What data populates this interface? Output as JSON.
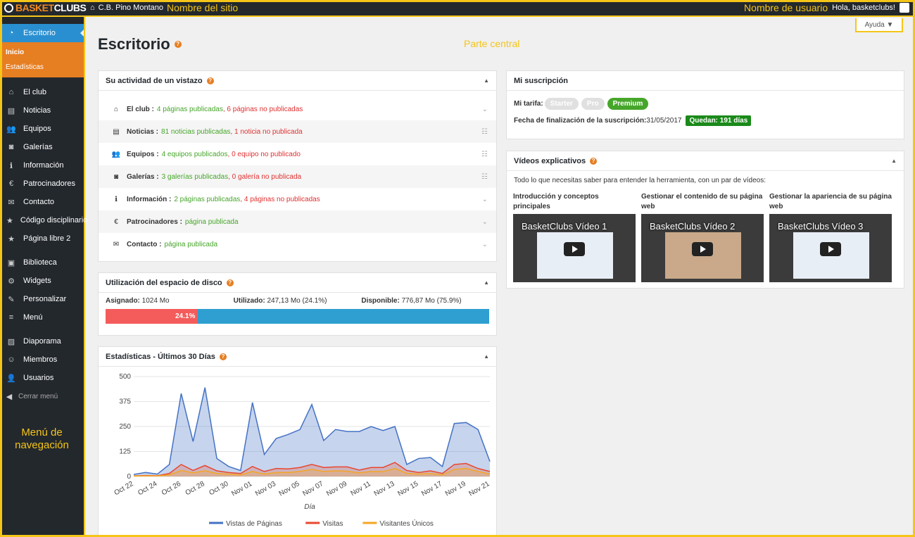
{
  "topbar": {
    "logo_left": "BASKET",
    "logo_right": "CLUBS",
    "site_name": "C.B. Pino Montano",
    "site_annotation": "Nombre del sitio",
    "user_annotation": "Nombre de usuario",
    "greeting": "Hola, basketclubs!"
  },
  "sidebar": {
    "active": "Escritorio",
    "submenu": [
      "Inicio",
      "Estadísticas"
    ],
    "group1": [
      "El club",
      "Noticias",
      "Equipos",
      "Galerías",
      "Información",
      "Patrocinadores",
      "Contacto",
      "Código disciplinario",
      "Página libre 2"
    ],
    "group2": [
      "Biblioteca",
      "Widgets",
      "Personalizar",
      "Menú"
    ],
    "group3": [
      "Diaporama",
      "Miembros",
      "Usuarios"
    ],
    "collapse": "Cerrar menú",
    "annotation_line1": "Menú de",
    "annotation_line2": "navegación"
  },
  "main": {
    "help_button": "Ayuda ▼",
    "title": "Escritorio",
    "center_annotation": "Parte central"
  },
  "activity": {
    "title": "Su actividad de un vistazo",
    "rows": [
      {
        "label": "El club :",
        "pub": "4 páginas publicadas",
        "unpub": ", 6 páginas no publicadas"
      },
      {
        "label": "Noticias :",
        "pub": "81 noticias publicadas",
        "unpub": ", 1 noticia no publicada"
      },
      {
        "label": "Equipos :",
        "pub": "4 equipos publicados",
        "unpub": ", 0 equipo no publicado"
      },
      {
        "label": "Galerías :",
        "pub": "3 galerías publicadas",
        "unpub": ", 0 galería no publicada"
      },
      {
        "label": "Información :",
        "pub": "2 páginas publicadas",
        "unpub": ", 4 páginas no publicadas"
      },
      {
        "label": "Patrocinadores :",
        "pub": "página publicada",
        "unpub": ""
      },
      {
        "label": "Contacto :",
        "pub": "página publicada",
        "unpub": ""
      }
    ]
  },
  "disk": {
    "title": "Utilización del espacio de disco",
    "assigned_label": "Asignado:",
    "assigned": " 1024 Mo",
    "used_label": "Utilizado:",
    "used": " 247,13 Mo (24.1%)",
    "available_label": "Disponible:",
    "available": " 776,87 Mo (75.9%)",
    "percent_text": "24.1%",
    "percent": 24.1
  },
  "stats": {
    "title": "Estadísticas - Últimos 30 Días"
  },
  "chart_data": {
    "type": "area",
    "title": "",
    "xlabel": "Día",
    "ylabel": "",
    "ylim": [
      0,
      500
    ],
    "yticks": [
      0,
      125,
      250,
      375,
      500
    ],
    "x": [
      "Oct 22",
      "Oct 23",
      "Oct 24",
      "Oct 25",
      "Oct 26",
      "Oct 27",
      "Oct 28",
      "Oct 29",
      "Oct 30",
      "Oct 31",
      "Nov 01",
      "Nov 02",
      "Nov 03",
      "Nov 04",
      "Nov 05",
      "Nov 06",
      "Nov 07",
      "Nov 08",
      "Nov 09",
      "Nov 10",
      "Nov 11",
      "Nov 12",
      "Nov 13",
      "Nov 14",
      "Nov 15",
      "Nov 16",
      "Nov 17",
      "Nov 18",
      "Nov 19",
      "Nov 20",
      "Nov 21"
    ],
    "xticks": [
      "Oct 22",
      "Oct 24",
      "Oct 26",
      "Oct 28",
      "Oct 30",
      "Nov 01",
      "Nov 03",
      "Nov 05",
      "Nov 07",
      "Nov 09",
      "Nov 11",
      "Nov 13",
      "Nov 15",
      "Nov 17",
      "Nov 19",
      "Nov 21"
    ],
    "series": [
      {
        "name": "Vistas de Páginas",
        "color": "#4472c4",
        "values": [
          10,
          20,
          12,
          60,
          415,
          175,
          445,
          90,
          50,
          30,
          370,
          110,
          190,
          210,
          235,
          360,
          180,
          235,
          225,
          225,
          250,
          230,
          250,
          60,
          90,
          95,
          50,
          265,
          270,
          235,
          75
        ]
      },
      {
        "name": "Visitas",
        "color": "#e8472f",
        "values": [
          3,
          5,
          4,
          15,
          60,
          30,
          55,
          28,
          20,
          15,
          50,
          25,
          40,
          38,
          45,
          60,
          45,
          48,
          48,
          32,
          45,
          45,
          70,
          30,
          20,
          28,
          15,
          60,
          65,
          40,
          25
        ]
      },
      {
        "name": "Visitantes Únicos",
        "color": "#f5a623",
        "values": [
          2,
          3,
          3,
          8,
          30,
          18,
          28,
          15,
          12,
          8,
          25,
          12,
          20,
          20,
          25,
          35,
          25,
          28,
          26,
          18,
          25,
          24,
          40,
          16,
          12,
          15,
          8,
          35,
          40,
          25,
          12
        ]
      }
    ],
    "legend": "bottom",
    "grid": true
  },
  "subscription": {
    "title": "Mi suscripción",
    "tariff_label": "Mi tarifa:",
    "plans": [
      "Starter",
      "Pro",
      "Premium"
    ],
    "end_label": "Fecha de finalización de la suscripción:",
    "end_date": " 31/05/2017",
    "remaining": "Quedan: 191 días"
  },
  "videos": {
    "title": "Vídeos explicativos",
    "intro": "Todo lo que necesitas saber para entender la herramienta, con un par de vídeos:",
    "items": [
      {
        "title": "Introducción y conceptos principales",
        "caption": "BasketClubs Vídeo 1"
      },
      {
        "title": "Gestionar el contenido de su página web",
        "caption": "BasketClubs Vídeo 2"
      },
      {
        "title": "Gestionar la apariencia de su página web",
        "caption": "BasketClubs Vídeo 3"
      }
    ]
  }
}
